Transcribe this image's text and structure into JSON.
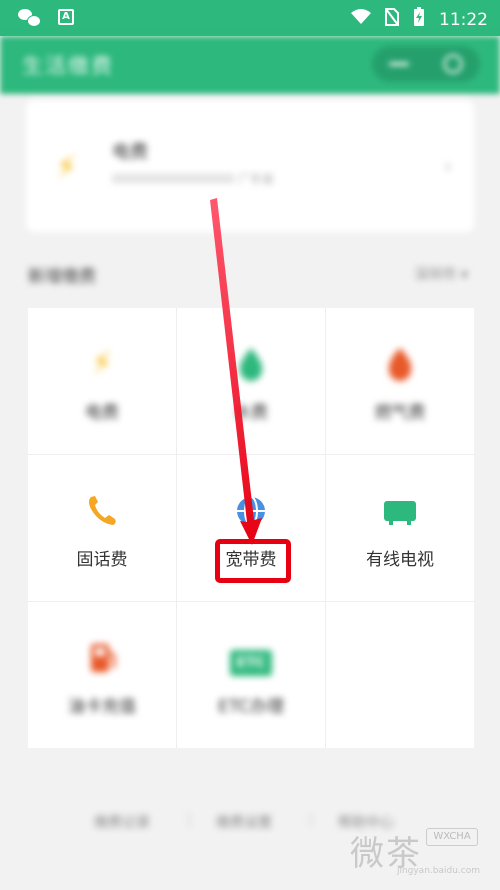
{
  "status_bar": {
    "time": "11:22"
  },
  "app_bar": {
    "title": "生活缴费"
  },
  "electric_card": {
    "name": "电费",
    "account": "0000000000000000 广东省",
    "chevron": "›"
  },
  "section": {
    "title": "新增缴费",
    "more": "深圳市 ▾"
  },
  "grid": {
    "items": [
      {
        "label": "电费",
        "icon": "⚡",
        "color": "#f5b400"
      },
      {
        "label": "水费",
        "icon": "💧",
        "color": "#2db87d"
      },
      {
        "label": "燃气费",
        "icon": "🔥",
        "color": "#e8592a"
      },
      {
        "label": "固话费",
        "icon": "📞",
        "color": "#f5a623"
      },
      {
        "label": "宽带费",
        "icon": "🌐",
        "color": "#4a90e2"
      },
      {
        "label": "有线电视",
        "icon": "📺",
        "color": "#2db87d"
      },
      {
        "label": "油卡充值",
        "icon": "⛽",
        "color": "#e8592a"
      },
      {
        "label": "ETC办理",
        "icon": "ETC",
        "color": "#2db87d"
      }
    ]
  },
  "footer": {
    "records": "缴费记录",
    "settings": "缴费设置",
    "help": "帮助中心"
  },
  "watermark": {
    "text": "微茶",
    "badge": "WXCHA",
    "url": "jingyan.baidu.com"
  },
  "colors": {
    "primary": "#2db87d",
    "highlight": "#e60012"
  }
}
